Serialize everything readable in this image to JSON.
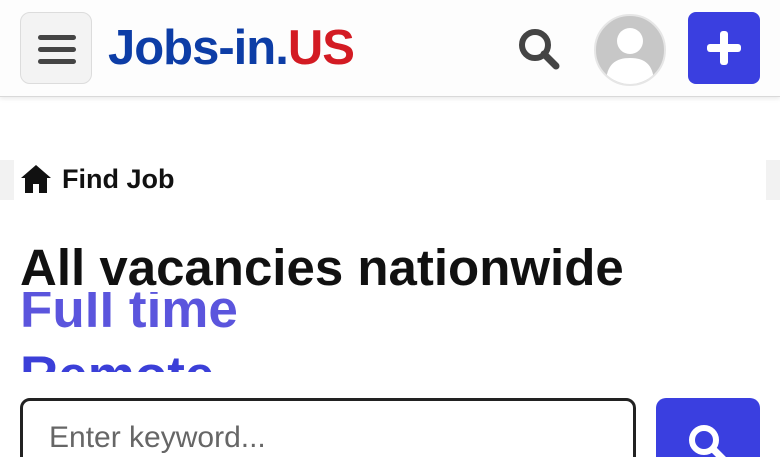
{
  "header": {
    "menu_icon": "hamburger-menu-icon",
    "logo": {
      "part1": "Jobs-in.",
      "part2": "US"
    },
    "search_icon": "search-icon",
    "avatar_icon": "user-avatar-icon",
    "add_icon": "plus-icon"
  },
  "breadcrumb": {
    "icon": "home-icon",
    "label": "Find Job"
  },
  "main": {
    "title": "All vacancies nationwide",
    "rotating_terms": [
      "Full time",
      "Remote"
    ]
  },
  "search": {
    "placeholder": "Enter keyword...",
    "value": "",
    "submit_icon": "search-icon"
  },
  "colors": {
    "brand_blue": "#0d3da6",
    "brand_red": "#d31b23",
    "accent": "#3a3fe0",
    "rotator_purple": "#5b55dd"
  }
}
